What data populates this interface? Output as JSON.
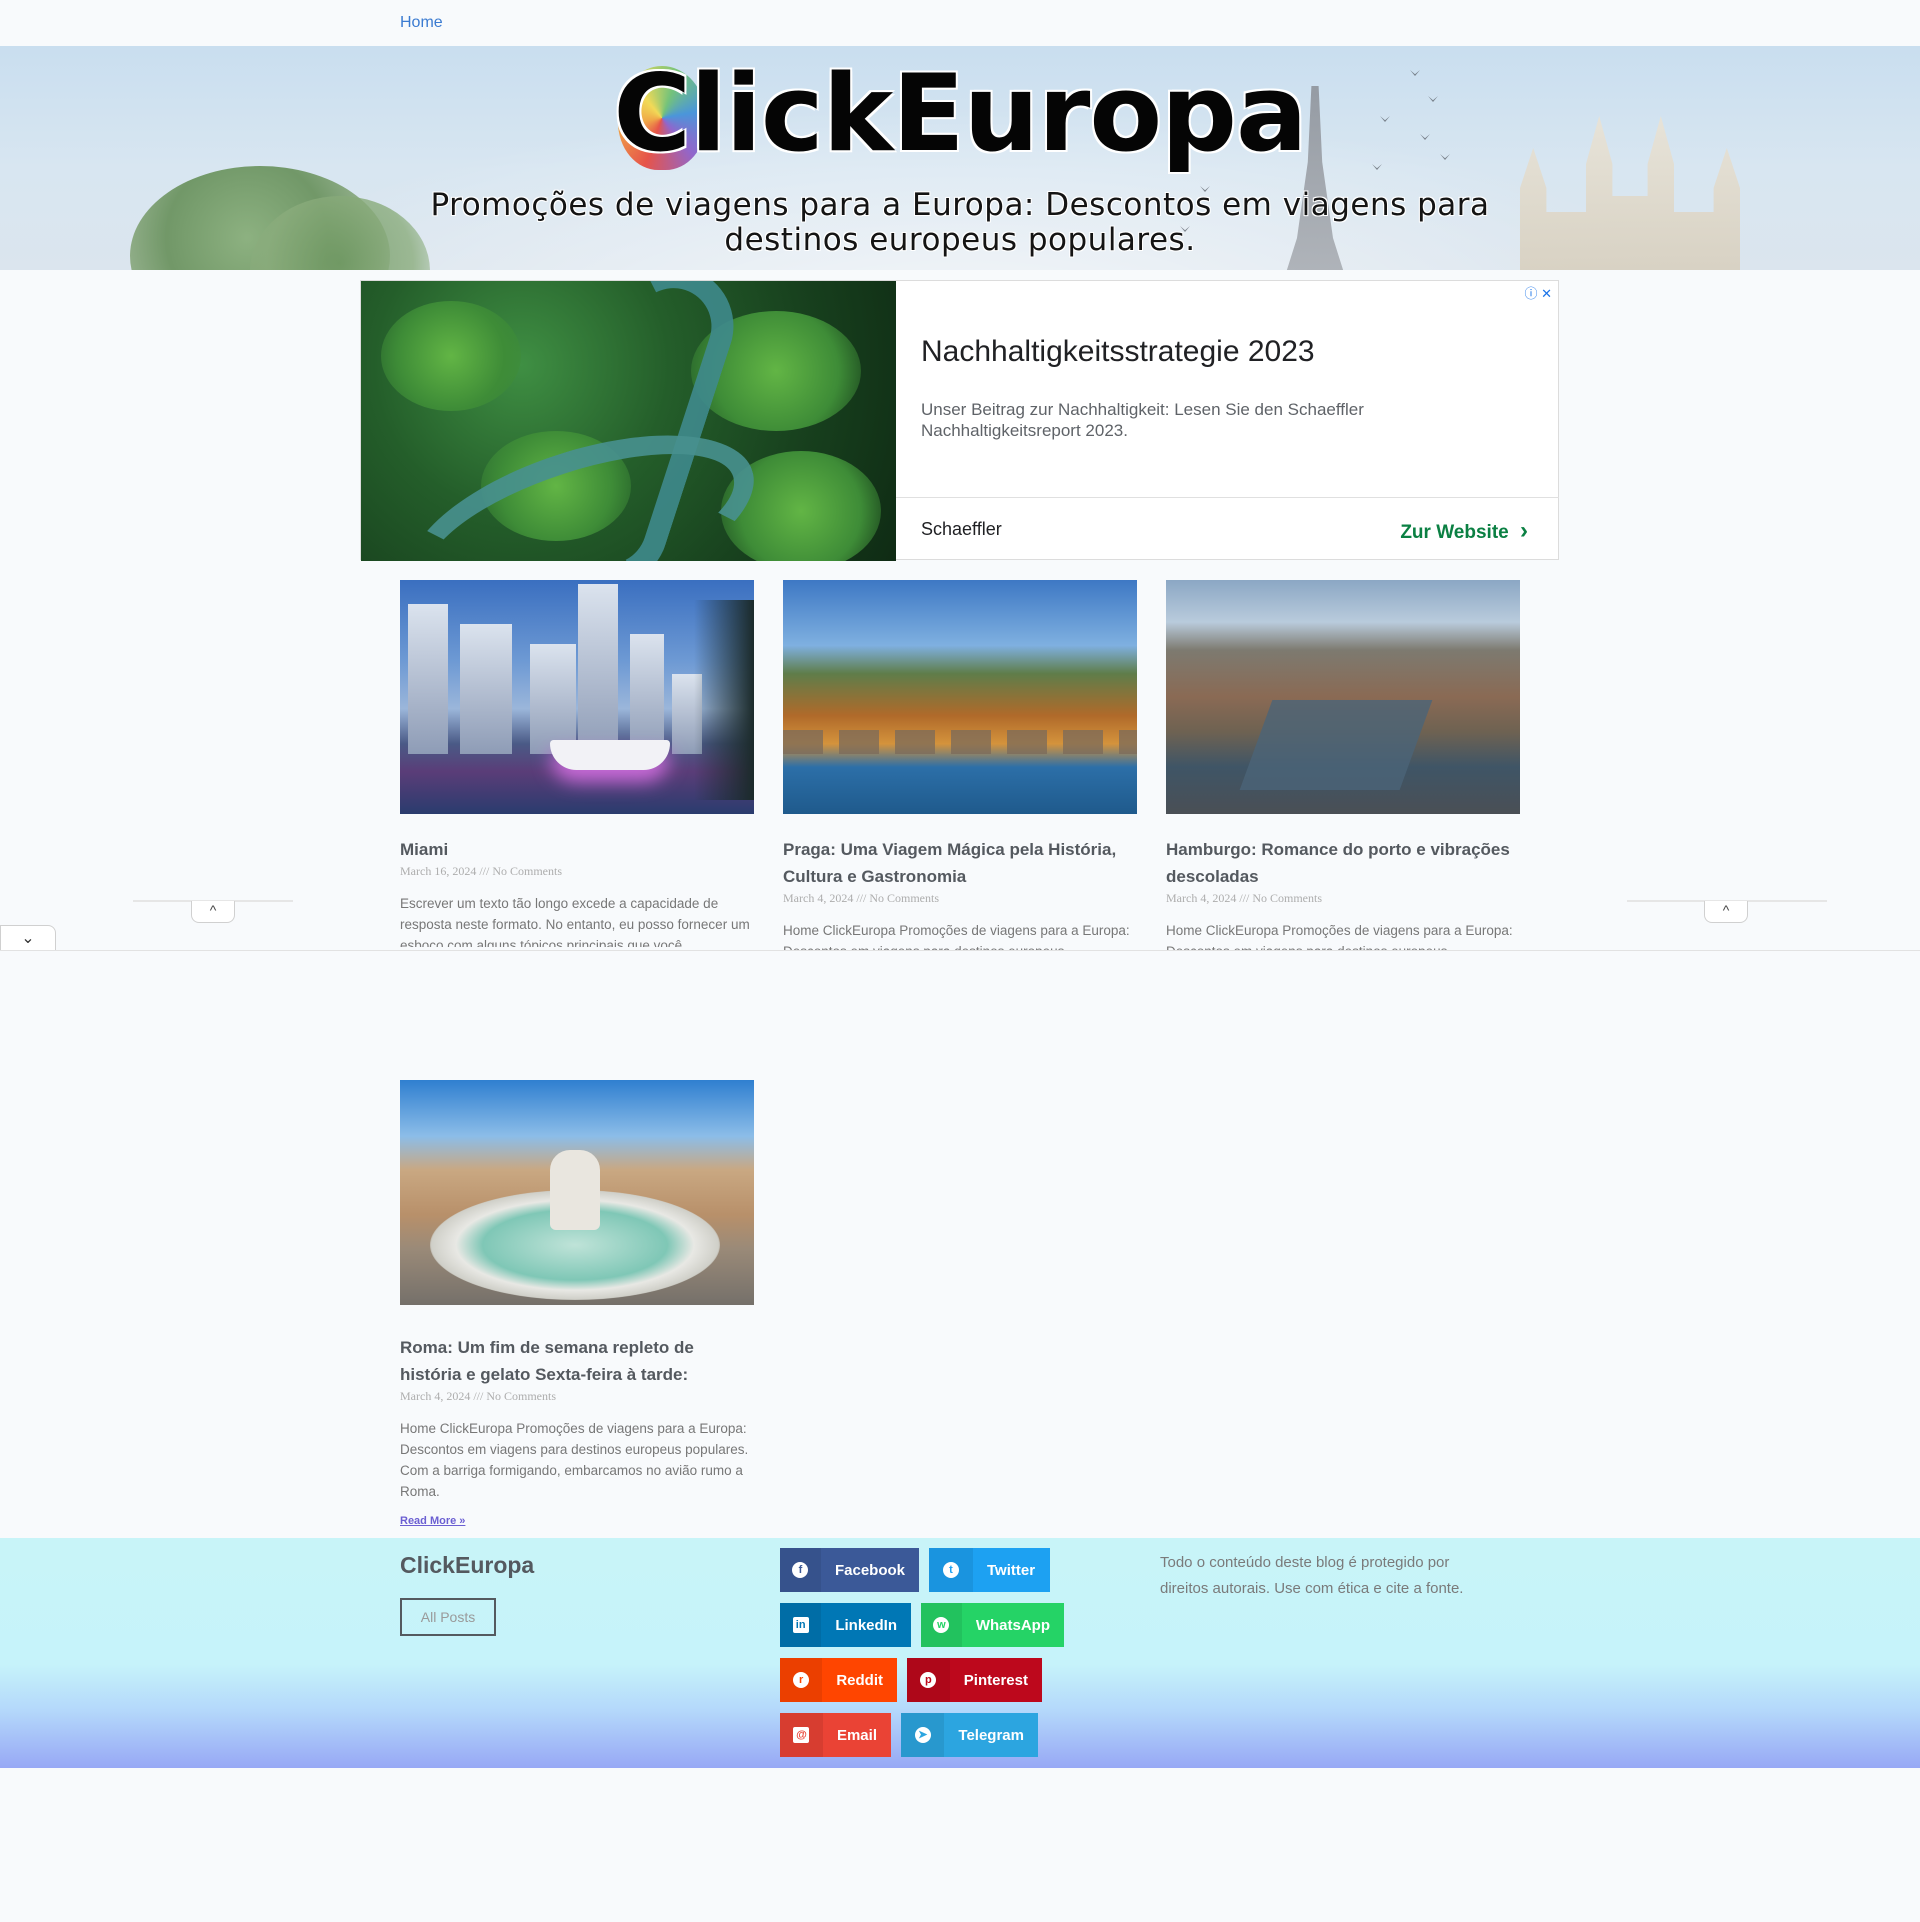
{
  "nav": {
    "home": "Home"
  },
  "hero": {
    "title": "ClickEuropa",
    "subtitle": "Promoções de viagens para a Europa: Descontos em viagens para destinos europeus populares."
  },
  "ad": {
    "title": "Nachhaltigkeitsstrategie 2023",
    "description": "Unser Beitrag zur Nachhaltigkeit: Lesen Sie den Schaeffler Nachhaltigkeitsreport 2023.",
    "brand": "Schaeffler",
    "cta": "Zur Website",
    "cta_chevron": "›",
    "info": "ⓘ ✕"
  },
  "posts": [
    {
      "title": "Miami",
      "date": "March 16, 2024",
      "sep": "///",
      "comments": "No Comments",
      "excerpt": "Escrever um texto tão longo excede a capacidade de resposta neste formato. No entanto, eu posso fornecer um esboço com alguns tópicos principais que você"
    },
    {
      "title": "Praga: Uma Viagem Mágica pela História, Cultura e Gastronomia",
      "date": "March 4, 2024",
      "sep": "///",
      "comments": "No Comments",
      "excerpt": "Home ClickEuropa Promoções de viagens para a Europa: Descontos em viagens para destinos europeus"
    },
    {
      "title": "Hamburgo: Romance do porto e vibrações descoladas",
      "date": "March 4, 2024",
      "sep": "///",
      "comments": "No Comments",
      "excerpt": "Home ClickEuropa Promoções de viagens para a Europa: Descontos em viagens para destinos europeus"
    },
    {
      "title": "Roma: Um fim de semana repleto de história e gelato Sexta-feira à tarde:",
      "date": "March 4, 2024",
      "sep": "///",
      "comments": "No Comments",
      "excerpt": "Home ClickEuropa Promoções de viagens para a Europa: Descontos em viagens para destinos europeus populares. Com a barriga formigando, embarcamos no avião rumo a Roma.",
      "read_more": "Read More »"
    }
  ],
  "sticky": {
    "collapse": "⌄",
    "expand": "^"
  },
  "footer": {
    "brand": "ClickEuropa",
    "all_posts": "All Posts",
    "copyright": "Todo o conteúdo deste blog é protegido por direitos autorais. Use com ética e cite a fonte.",
    "share": [
      {
        "label": "Facebook",
        "icon": "facebook-icon",
        "color": "#3b5998"
      },
      {
        "label": "Twitter",
        "icon": "twitter-icon",
        "color": "#1da1f2"
      },
      {
        "label": "LinkedIn",
        "icon": "linkedin-icon",
        "color": "#0077b5"
      },
      {
        "label": "WhatsApp",
        "icon": "whatsapp-icon",
        "color": "#25d366"
      },
      {
        "label": "Reddit",
        "icon": "reddit-icon",
        "color": "#ff4500"
      },
      {
        "label": "Pinterest",
        "icon": "pinterest-icon",
        "color": "#bd081c"
      },
      {
        "label": "Email",
        "icon": "envelope-icon",
        "color": "#ea4335"
      },
      {
        "label": "Telegram",
        "icon": "telegram-icon",
        "color": "#2ca5e0"
      }
    ]
  }
}
